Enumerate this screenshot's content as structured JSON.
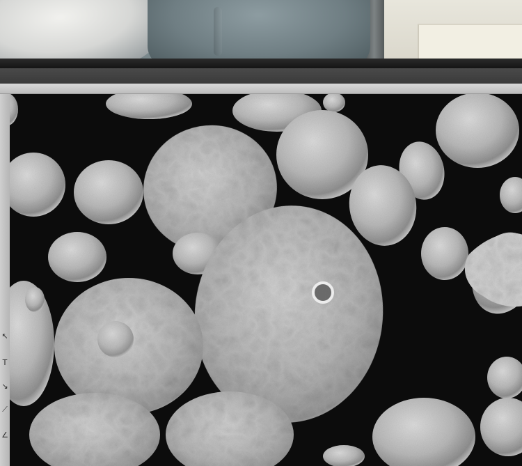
{
  "window": {
    "title": ""
  },
  "menubar": {
    "items": [
      {
        "label": ""
      },
      {
        "label": ""
      },
      {
        "label": ""
      },
      {
        "label": ""
      },
      {
        "label": ""
      }
    ]
  },
  "toolbar": {
    "tools": [
      {
        "icon": "pointer-icon",
        "glyph": "↖"
      },
      {
        "icon": "text-tool-icon",
        "glyph": "T"
      },
      {
        "icon": "measure-icon",
        "glyph": "↘"
      },
      {
        "icon": "line-tool-icon",
        "glyph": "⟋"
      },
      {
        "icon": "angle-tool-icon",
        "glyph": "∠"
      }
    ]
  },
  "sem_image": {
    "description_icon": "sem-particles-image",
    "colors": {
      "background": "#0c0c0c",
      "particle": "#bdbdbd"
    }
  }
}
